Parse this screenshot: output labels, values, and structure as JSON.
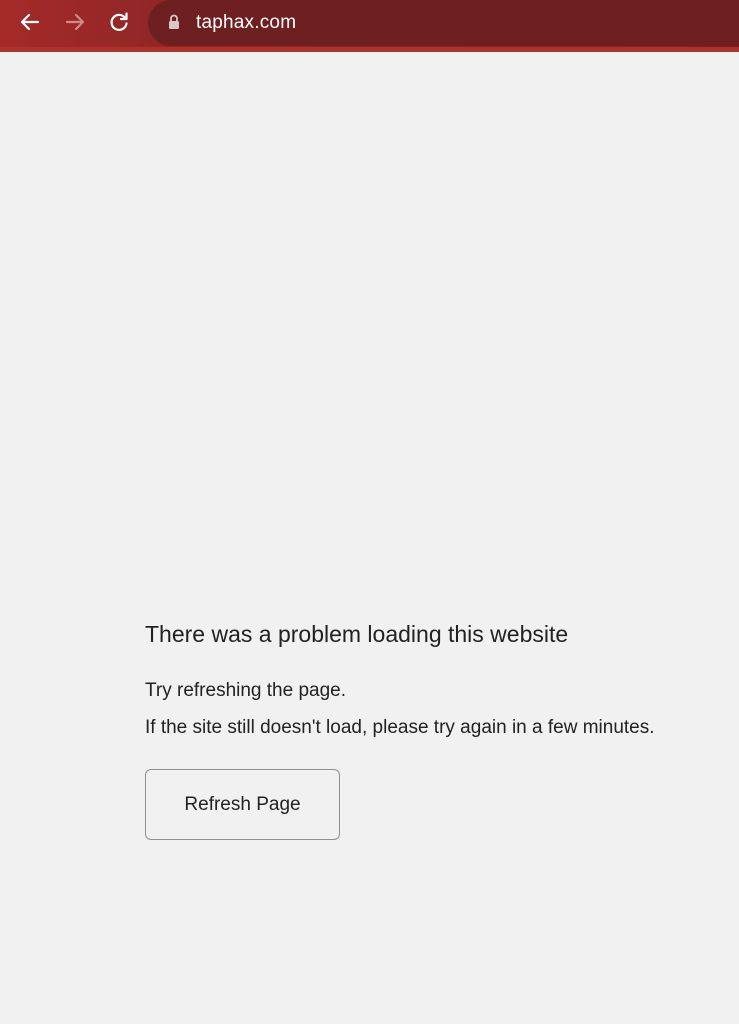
{
  "browser": {
    "url": "taphax.com",
    "icons": {
      "back": "arrow-left-icon",
      "forward": "arrow-right-icon",
      "reload": "reload-icon",
      "lock": "lock-icon"
    },
    "colors": {
      "toolbar": "#8a2526",
      "omnibox": "#6e1f20",
      "bottom_border": "#b1312d"
    }
  },
  "error_page": {
    "title": "There was a problem loading this website",
    "line1": "Try refreshing the page.",
    "line2": "If the site still doesn't load, please try again in a few minutes.",
    "refresh_button": "Refresh Page"
  }
}
